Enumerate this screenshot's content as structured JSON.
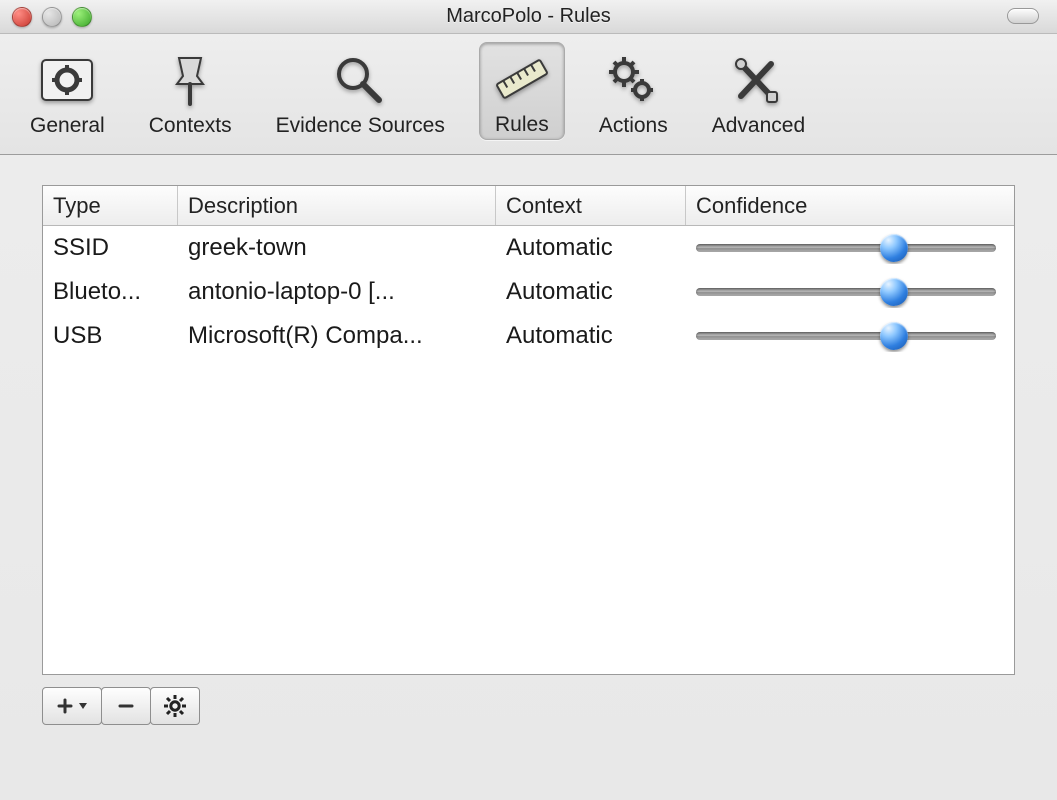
{
  "window": {
    "title": "MarcoPolo - Rules"
  },
  "toolbar": {
    "items": [
      {
        "id": "general",
        "label": "General",
        "icon": "switch-slider-icon",
        "selected": false
      },
      {
        "id": "contexts",
        "label": "Contexts",
        "icon": "pushpin-icon",
        "selected": false
      },
      {
        "id": "evidence-sources",
        "label": "Evidence Sources",
        "icon": "magnifier-icon",
        "selected": false
      },
      {
        "id": "rules",
        "label": "Rules",
        "icon": "ruler-icon",
        "selected": true
      },
      {
        "id": "actions",
        "label": "Actions",
        "icon": "gears-icon",
        "selected": false
      },
      {
        "id": "advanced",
        "label": "Advanced",
        "icon": "tools-icon",
        "selected": false
      }
    ]
  },
  "table": {
    "columns": {
      "type": "Type",
      "description": "Description",
      "context": "Context",
      "confidence": "Confidence"
    },
    "rows": [
      {
        "type": "SSID",
        "description": "greek-town",
        "context": "Automatic",
        "confidence": 0.66
      },
      {
        "type": "Blueto...",
        "description": "antonio-laptop-0 [...",
        "context": "Automatic",
        "confidence": 0.66
      },
      {
        "type": "USB",
        "description": "Microsoft(R) Compa...",
        "context": "Automatic",
        "confidence": 0.66
      }
    ]
  },
  "footer": {
    "add_label": "+",
    "remove_label": "−",
    "settings_label": "settings"
  }
}
